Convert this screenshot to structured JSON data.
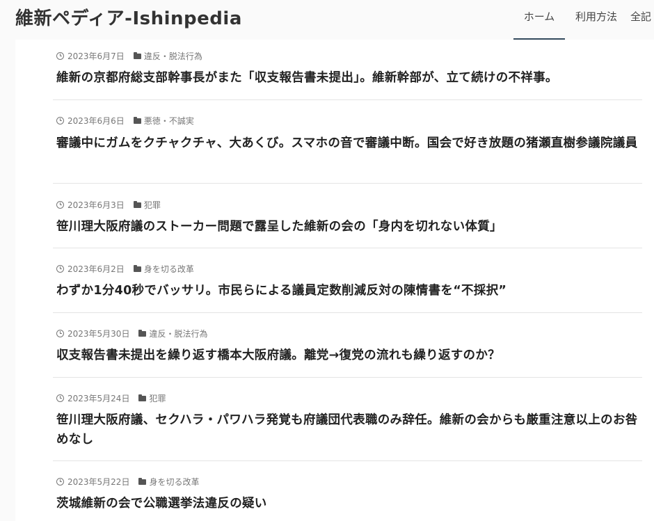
{
  "header": {
    "site_title": "維新ペディア-Ishinpedia",
    "nav": [
      {
        "label": "ホーム",
        "active": true
      },
      {
        "label": "利用方法",
        "active": false
      },
      {
        "label": "全記",
        "active": false
      }
    ]
  },
  "posts": [
    {
      "date": "2023年6月7日",
      "category": "違反・脱法行為",
      "title": "維新の京都府総支部幹事長がまた「収支報告書未提出」。維新幹部が、立て続けの不祥事。"
    },
    {
      "date": "2023年6月6日",
      "category": "悪徳・不誠実",
      "title": "審議中にガムをクチャクチャ、大あくび。スマホの音で審議中断。国会で好き放題の猪瀬直樹参議院議員"
    },
    {
      "date": "2023年6月3日",
      "category": "犯罪",
      "title": "笹川理大阪府議のストーカー問題で露呈した維新の会の「身内を切れない体質」"
    },
    {
      "date": "2023年6月2日",
      "category": "身を切る改革",
      "title": "わずか1分40秒でバッサリ。市民らによる議員定数削減反対の陳情書を“不採択”"
    },
    {
      "date": "2023年5月30日",
      "category": "違反・脱法行為",
      "title": "収支報告書未提出を繰り返す橋本大阪府議。離党→復党の流れも繰り返すのか？"
    },
    {
      "date": "2023年5月24日",
      "category": "犯罪",
      "title": "笹川理大阪府議、セクハラ・パワハラ発覚も府議団代表職のみ辞任。維新の会からも厳重注意以上のお咎めなし"
    },
    {
      "date": "2023年5月22日",
      "category": "身を切る改革",
      "title": "茨城維新の会で公職選挙法違反の疑い"
    }
  ]
}
